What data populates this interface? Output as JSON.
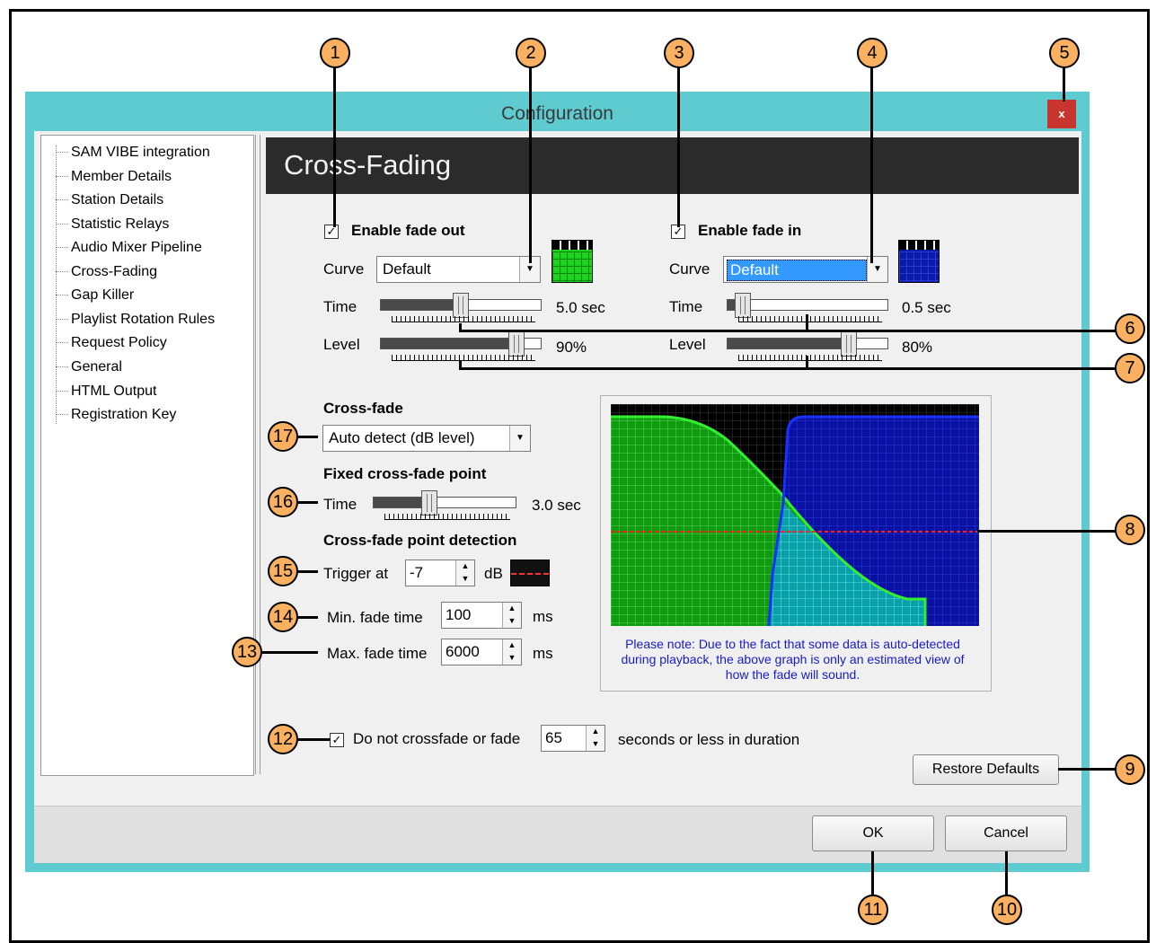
{
  "window": {
    "title": "Configuration",
    "close_glyph": "x"
  },
  "sidebar": {
    "items": [
      {
        "label": "SAM VIBE integration"
      },
      {
        "label": "Member Details"
      },
      {
        "label": "Station Details"
      },
      {
        "label": "Statistic Relays"
      },
      {
        "label": "Audio Mixer Pipeline"
      },
      {
        "label": "Cross-Fading"
      },
      {
        "label": "Gap Killer"
      },
      {
        "label": "Playlist Rotation Rules"
      },
      {
        "label": "Request Policy"
      },
      {
        "label": "General"
      },
      {
        "label": "HTML Output"
      },
      {
        "label": "Registration Key"
      }
    ]
  },
  "page": {
    "title": "Cross-Fading"
  },
  "fade_out": {
    "enable_label": "Enable fade out",
    "enabled": true,
    "curve_label": "Curve",
    "curve_value": "Default",
    "time_label": "Time",
    "time_value": "5.0 sec",
    "time_fraction": 0.5,
    "level_label": "Level",
    "level_value": "90%",
    "level_fraction": 0.9,
    "color": "#1ed21e"
  },
  "fade_in": {
    "enable_label": "Enable fade in",
    "enabled": true,
    "curve_label": "Curve",
    "curve_value": "Default",
    "time_label": "Time",
    "time_value": "0.5 sec",
    "time_fraction": 0.05,
    "level_label": "Level",
    "level_value": "80%",
    "level_fraction": 0.8,
    "color": "#0a1aa8"
  },
  "crossfade": {
    "section_label": "Cross-fade",
    "mode_value": "Auto detect (dB level)",
    "fixed_label": "Fixed cross-fade point",
    "time_label": "Time",
    "time_value": "3.0 sec",
    "time_fraction": 0.35,
    "detection_label": "Cross-fade point detection",
    "trigger_label": "Trigger at",
    "trigger_value": "-7",
    "trigger_unit": "dB",
    "min_label": "Min. fade time",
    "min_value": "100",
    "min_unit": "ms",
    "max_label": "Max. fade time",
    "max_value": "6000",
    "max_unit": "ms"
  },
  "graph": {
    "note": "Please note: Due to the fact that some data is auto-detected during playback, the above graph is only an estimated view of how the fade will sound."
  },
  "skip": {
    "label": "Do not crossfade or fade",
    "checked": true,
    "value": "65",
    "suffix": "seconds or less in duration"
  },
  "buttons": {
    "restore": "Restore Defaults",
    "ok": "OK",
    "cancel": "Cancel"
  },
  "callouts": [
    "1",
    "2",
    "3",
    "4",
    "5",
    "6",
    "7",
    "8",
    "9",
    "10",
    "11",
    "12",
    "13",
    "14",
    "15",
    "16",
    "17"
  ],
  "colors": {
    "accent": "#5dcbcf",
    "callout": "#f9b060",
    "header": "#2b2b2b",
    "close": "#c7352d"
  }
}
